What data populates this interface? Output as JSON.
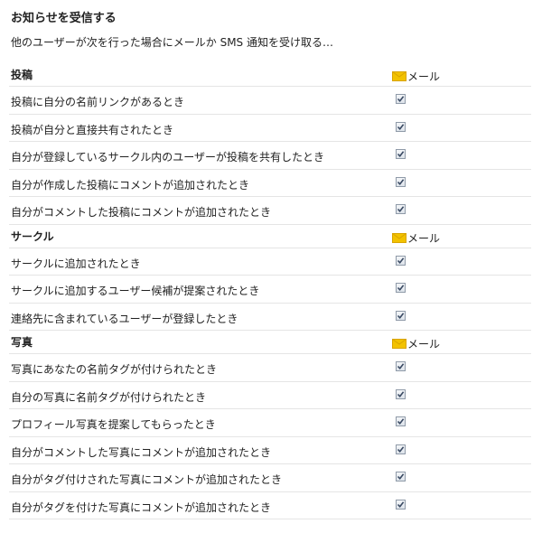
{
  "page": {
    "title": "お知らせを受信する",
    "subtitle": "他のユーザーが次を行った場合にメールか SMS 通知を受け取る…"
  },
  "sections": [
    {
      "title": "投稿",
      "channel_label": "メール",
      "items": [
        {
          "label": "投稿に自分の名前リンクがあるとき",
          "checked": true
        },
        {
          "label": "投稿が自分と直接共有されたとき",
          "checked": true
        },
        {
          "label": "自分が登録しているサークル内のユーザーが投稿を共有したとき",
          "checked": true
        },
        {
          "label": "自分が作成した投稿にコメントが追加されたとき",
          "checked": true
        },
        {
          "label": "自分がコメントした投稿にコメントが追加されたとき",
          "checked": true
        }
      ]
    },
    {
      "title": "サークル",
      "channel_label": "メール",
      "items": [
        {
          "label": "サークルに追加されたとき",
          "checked": true
        },
        {
          "label": "サークルに追加するユーザー候補が提案されたとき",
          "checked": true
        },
        {
          "label": "連絡先に含まれているユーザーが登録したとき",
          "checked": true
        }
      ]
    },
    {
      "title": "写真",
      "channel_label": "メール",
      "items": [
        {
          "label": "写真にあなたの名前タグが付けられたとき",
          "checked": true
        },
        {
          "label": "自分の写真に名前タグが付けられたとき",
          "checked": true
        },
        {
          "label": "プロフィール写真を提案してもらったとき",
          "checked": true
        },
        {
          "label": "自分がコメントした写真にコメントが追加されたとき",
          "checked": true
        },
        {
          "label": "自分がタグ付けされた写真にコメントが追加されたとき",
          "checked": true
        },
        {
          "label": "自分がタグを付けた写真にコメントが追加されたとき",
          "checked": true
        }
      ]
    }
  ],
  "icons": {
    "channel": "envelope-icon",
    "check": "checkmark-icon"
  },
  "colors": {
    "envelope": "#f2c200",
    "divider": "#e5e5e5",
    "check": "#3a4a63"
  }
}
